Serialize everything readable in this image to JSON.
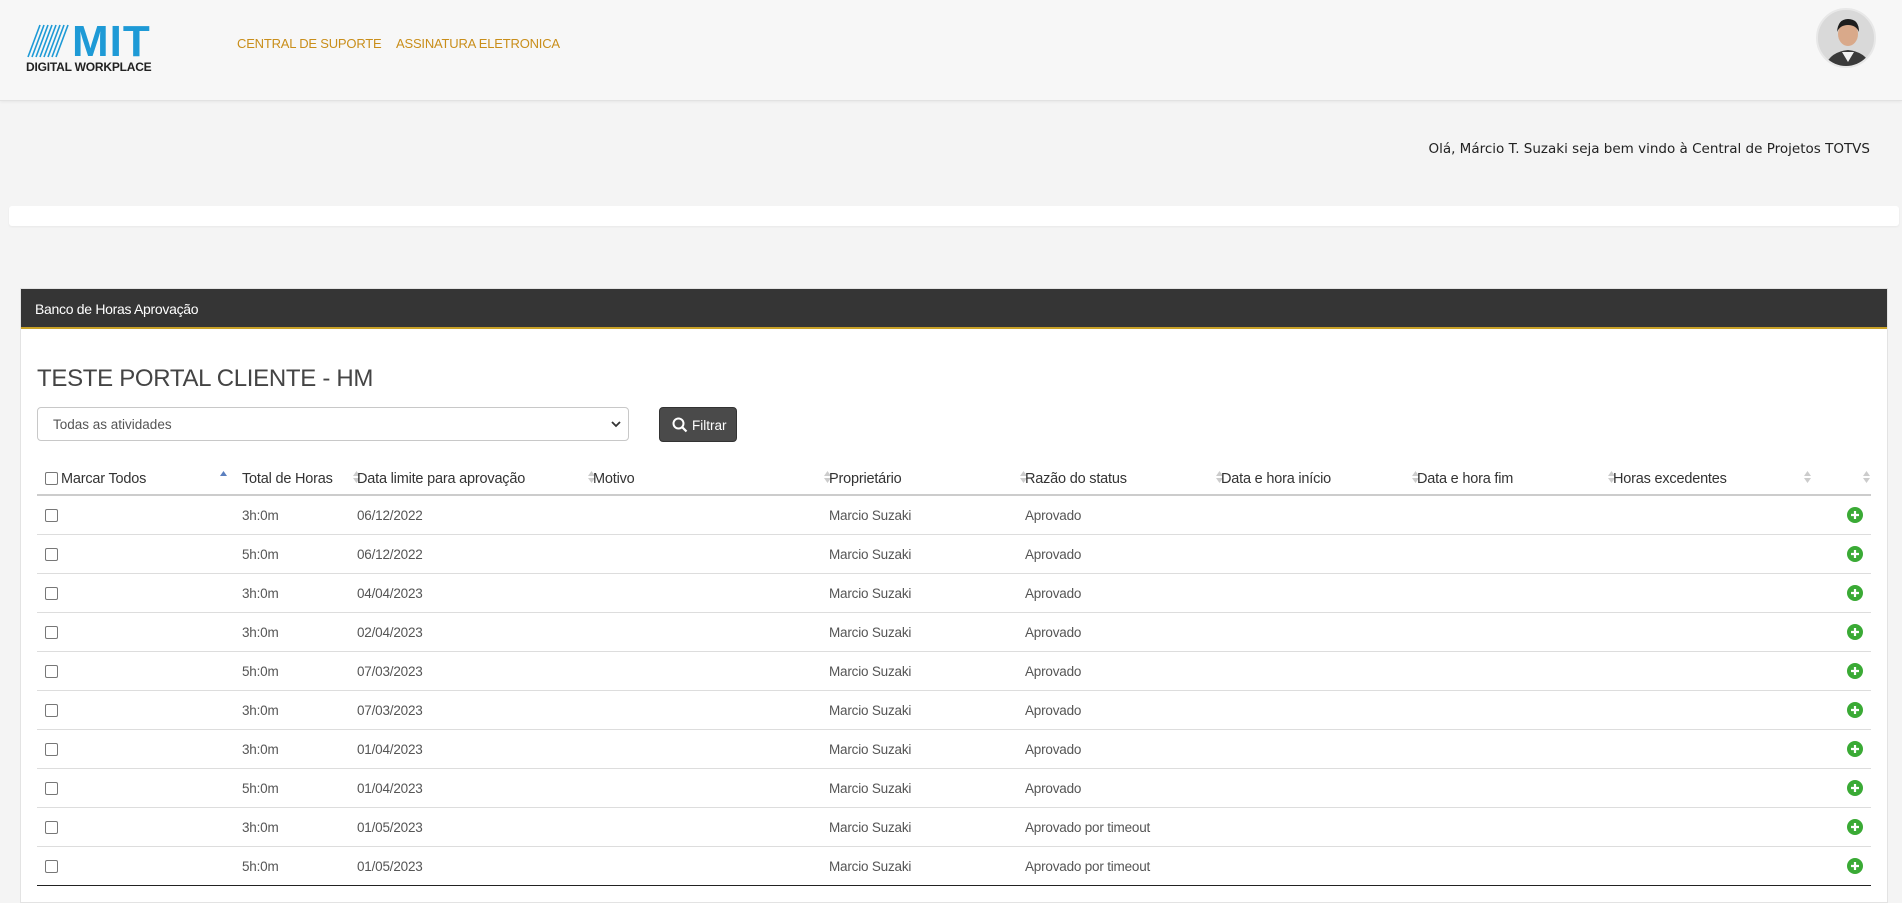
{
  "header": {
    "logo_main": "MIT",
    "logo_sub": "DIGITAL WORKPLACE",
    "nav": [
      "CENTRAL DE SUPORTE",
      "ASSINATURA ELETRONICA"
    ],
    "welcome": "Olá, Márcio T. Suzaki seja bem vindo à Central de Projetos TOTVS"
  },
  "panel": {
    "title": "Banco de Horas Aprovação",
    "heading": "TESTE PORTAL CLIENTE - HM",
    "filter_select": "Todas as atividades",
    "filter_button": "Filtrar"
  },
  "table": {
    "columns": [
      "Marcar Todos",
      "Total de Horas",
      "Data limite para aprovação",
      "Motivo",
      "Proprietário",
      "Razão do status",
      "Data e hora início",
      "Data e hora fim",
      "Horas excedentes"
    ],
    "rows": [
      {
        "horas": "3h:0m",
        "data_limite": "06/12/2022",
        "motivo": "",
        "proprietario": "Marcio Suzaki",
        "status": "Aprovado",
        "inicio": "",
        "fim": "",
        "excedentes": ""
      },
      {
        "horas": "5h:0m",
        "data_limite": "06/12/2022",
        "motivo": "",
        "proprietario": "Marcio Suzaki",
        "status": "Aprovado",
        "inicio": "",
        "fim": "",
        "excedentes": ""
      },
      {
        "horas": "3h:0m",
        "data_limite": "04/04/2023",
        "motivo": "",
        "proprietario": "Marcio Suzaki",
        "status": "Aprovado",
        "inicio": "",
        "fim": "",
        "excedentes": ""
      },
      {
        "horas": "3h:0m",
        "data_limite": "02/04/2023",
        "motivo": "",
        "proprietario": "Marcio Suzaki",
        "status": "Aprovado",
        "inicio": "",
        "fim": "",
        "excedentes": ""
      },
      {
        "horas": "5h:0m",
        "data_limite": "07/03/2023",
        "motivo": "",
        "proprietario": "Marcio Suzaki",
        "status": "Aprovado",
        "inicio": "",
        "fim": "",
        "excedentes": ""
      },
      {
        "horas": "3h:0m",
        "data_limite": "07/03/2023",
        "motivo": "",
        "proprietario": "Marcio Suzaki",
        "status": "Aprovado",
        "inicio": "",
        "fim": "",
        "excedentes": ""
      },
      {
        "horas": "3h:0m",
        "data_limite": "01/04/2023",
        "motivo": "",
        "proprietario": "Marcio Suzaki",
        "status": "Aprovado",
        "inicio": "",
        "fim": "",
        "excedentes": ""
      },
      {
        "horas": "5h:0m",
        "data_limite": "01/04/2023",
        "motivo": "",
        "proprietario": "Marcio Suzaki",
        "status": "Aprovado",
        "inicio": "",
        "fim": "",
        "excedentes": ""
      },
      {
        "horas": "3h:0m",
        "data_limite": "01/05/2023",
        "motivo": "",
        "proprietario": "Marcio Suzaki",
        "status": "Aprovado por timeout",
        "inicio": "",
        "fim": "",
        "excedentes": ""
      },
      {
        "horas": "5h:0m",
        "data_limite": "01/05/2023",
        "motivo": "",
        "proprietario": "Marcio Suzaki",
        "status": "Aprovado por timeout",
        "inicio": "",
        "fim": "",
        "excedentes": ""
      }
    ]
  },
  "colors": {
    "brand_blue": "#1e9ad6",
    "nav_gold": "#c98e1a",
    "header_dark": "#353535",
    "add_green": "#3aaa35"
  },
  "icons": {
    "avatar": "user-avatar",
    "filter": "search-icon",
    "row_action": "plus-circle-icon"
  }
}
